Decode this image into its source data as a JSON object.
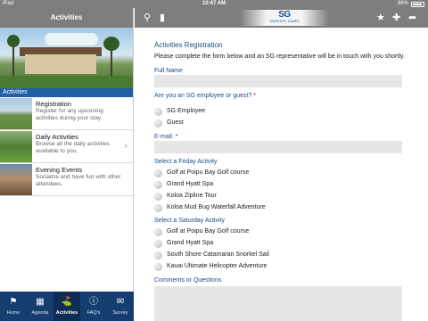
{
  "status_bar": {
    "carrier": "iPad",
    "time": "10:47 AM",
    "battery": "86%"
  },
  "sidebar": {
    "title": "Activities",
    "section_label": "Activities",
    "items": [
      {
        "title": "Registration",
        "description": "Register for any upcoming activities during your stay."
      },
      {
        "title": "Daily Activities",
        "description": "Browse all the daily activities available to you."
      },
      {
        "title": "Evening Events",
        "description": "Socialize and have fun with other attendees."
      }
    ]
  },
  "tabbar": {
    "tabs": [
      {
        "label": "Home",
        "icon": "home-icon"
      },
      {
        "label": "Agenda",
        "icon": "agenda-icon"
      },
      {
        "label": "Activities",
        "icon": "activities-icon",
        "active": true
      },
      {
        "label": "FAQ's",
        "icon": "info-icon"
      },
      {
        "label": "Survey",
        "icon": "survey-icon"
      }
    ]
  },
  "header": {
    "logo_text": "SG",
    "logo_subtext": "SCIENTIFIC GAMES",
    "icons": [
      "search-icon",
      "document-icon",
      "star-icon",
      "plus-icon",
      "share-icon"
    ]
  },
  "form": {
    "title": "Activities Registration",
    "intro": "Please complete the form below and an SG representative will be in touch with you shortly.",
    "full_name_label": "Full Name",
    "employee_question": "Are you an SG employee or guest?",
    "employee_options": [
      "SG Employee",
      "Guest"
    ],
    "email_label": "E-mail:",
    "required_mark": "*",
    "friday_label": "Select a Friday Activity",
    "friday_options": [
      "Golf at Poipu Bay Golf course",
      "Grand Hyatt Spa",
      "Koloa Zipline Tour",
      "Koloa Mud Bug Waterfall Adventure"
    ],
    "saturday_label": "Select a Saturday Activity",
    "saturday_options": [
      "Golf at Poipu Bay Golf course",
      "Grand Hyatt Spa",
      "South Shore Catamaran Snorkel Sail",
      "Kauai Ultimate Helicopter Adventure"
    ],
    "comments_label": "Comments or Questions"
  },
  "colors": {
    "accent": "#1f5fa6",
    "tabbar": "#153d6f",
    "header": "#7d7d7d",
    "label": "#1a4a8a"
  }
}
